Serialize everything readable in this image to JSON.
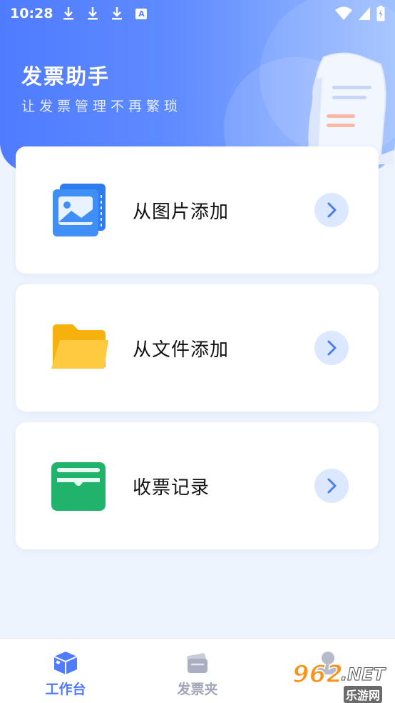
{
  "status_bar": {
    "time": "10:28",
    "badge": "A"
  },
  "header": {
    "title": "发票助手",
    "subtitle": "让发票管理不再繁琐"
  },
  "cards": [
    {
      "label": "从图片添加",
      "icon": "image-gallery-icon"
    },
    {
      "label": "从文件添加",
      "icon": "folder-icon"
    },
    {
      "label": "收票记录",
      "icon": "wallet-icon"
    }
  ],
  "bottom_nav": {
    "tabs": [
      {
        "label": "工作台",
        "icon": "box-icon",
        "active": true,
        "color": "#4f7bff"
      },
      {
        "label": "发票夹",
        "icon": "wallet-icon",
        "active": false,
        "color": "#a0a6b8"
      },
      {
        "label": "",
        "icon": "user-icon",
        "active": false
      }
    ]
  },
  "watermark": {
    "number": "962",
    "suffix": ".NET",
    "sub": "乐游网"
  },
  "colors": {
    "accent": "#4f7bff",
    "page_bg": "#eef4fe",
    "arrow_bg": "#dce8ff"
  }
}
